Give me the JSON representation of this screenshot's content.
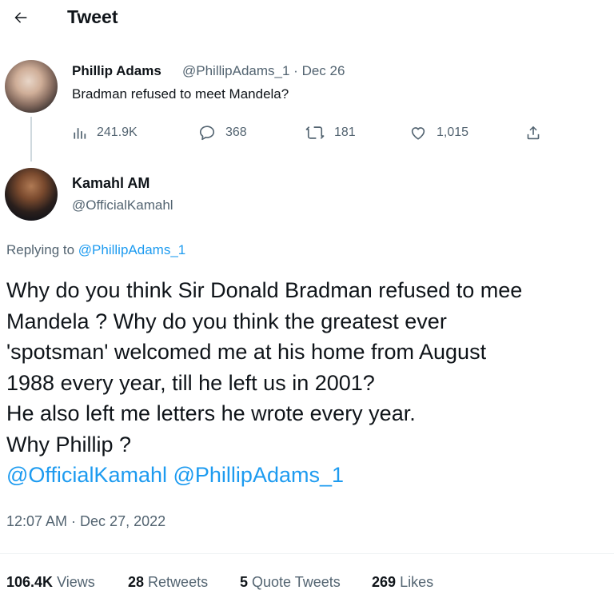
{
  "header": {
    "title": "Tweet"
  },
  "parent_tweet": {
    "name": "Phillip Adams",
    "handle": "@PhillipAdams_1",
    "separator": "·",
    "date": "Dec 26",
    "text": "Bradman refused to meet Mandela?",
    "actions": {
      "views": "241.9K",
      "replies": "368",
      "retweets": "181",
      "likes": "1,015"
    }
  },
  "tweet": {
    "name": "Kamahl AM",
    "handle": "@OfficialKamahl",
    "replying_prefix": "Replying to",
    "replying_to": "@PhillipAdams_1",
    "lines": [
      "Why do you think Sir Donald Bradman refused to mee",
      "Mandela ? Why do you think the greatest ever",
      "'spotsman' welcomed me at his home from August",
      "1988 every year, till he left us in 2001?",
      "He also left me letters he wrote every year.",
      "Why Phillip ?"
    ],
    "mentions": [
      "@OfficialKamahl",
      "@PhillipAdams_1"
    ],
    "timestamp": "12:07 AM · Dec 27, 2022"
  },
  "stats": {
    "views_count": "106.4K",
    "views_label": "Views",
    "retweets_count": "28",
    "retweets_label": "Retweets",
    "quotes_count": "5",
    "quotes_label": "Quote Tweets",
    "likes_count": "269",
    "likes_label": "Likes"
  },
  "colors": {
    "text": "#0f1419",
    "secondary": "#536471",
    "accent": "#1d9bf0",
    "divider": "#eff3f4"
  },
  "icons": [
    "back-arrow-icon",
    "views-icon",
    "reply-icon",
    "retweet-icon",
    "like-icon",
    "share-icon"
  ]
}
